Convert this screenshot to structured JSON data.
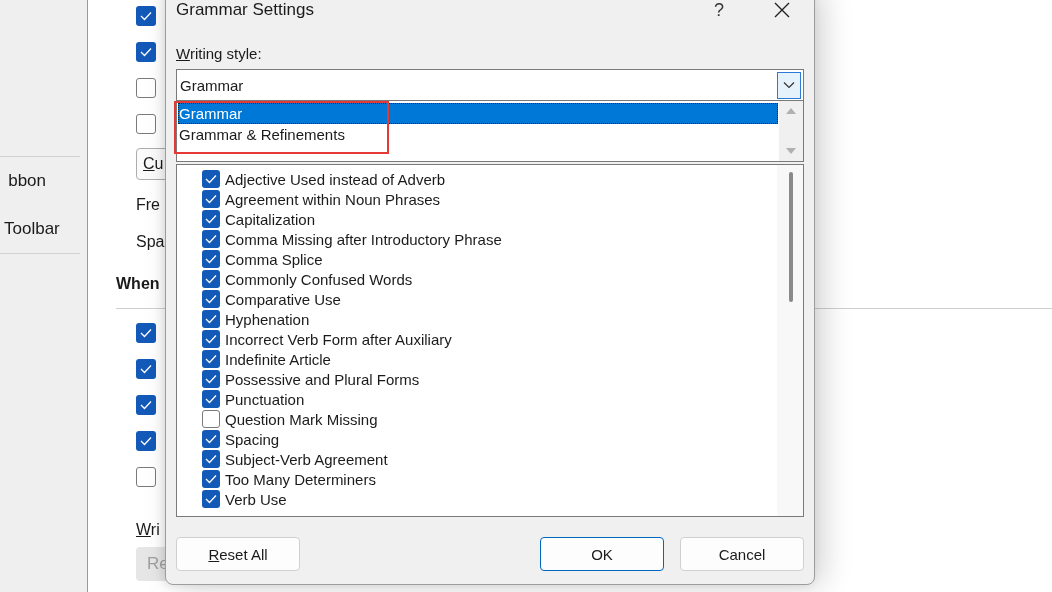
{
  "sidebar": {
    "items": [
      {
        "label": "bbon"
      },
      {
        "label": "Toolbar"
      }
    ]
  },
  "main": {
    "top_checkboxes": [
      {
        "checked": true
      },
      {
        "checked": true
      },
      {
        "checked": false
      },
      {
        "checked": false
      }
    ],
    "button": {
      "label": "Cu",
      "access_key": true
    },
    "rows": [
      {
        "label": "Fre"
      },
      {
        "label": "Spa"
      }
    ],
    "heading": "When",
    "bottom_checkboxes": [
      {
        "checked": true
      },
      {
        "checked": true
      },
      {
        "checked": true
      },
      {
        "checked": true
      },
      {
        "checked": false
      }
    ],
    "section_label": {
      "label": "Wri",
      "access_key": true
    },
    "section_button": {
      "label": "Re",
      "disabled": true
    }
  },
  "dialog": {
    "title": "Grammar Settings",
    "help": "?",
    "writing_style": {
      "label": "Writing style:",
      "access_key": true,
      "value": "Grammar",
      "options": [
        {
          "label": "Grammar",
          "selected": true
        },
        {
          "label": "Grammar & Refinements",
          "selected": false
        }
      ]
    },
    "rules": [
      {
        "label": "Adjective Used instead of Adverb",
        "checked": true
      },
      {
        "label": "Agreement within Noun Phrases",
        "checked": true
      },
      {
        "label": "Capitalization",
        "checked": true
      },
      {
        "label": "Comma Missing after Introductory Phrase",
        "checked": true
      },
      {
        "label": "Comma Splice",
        "checked": true
      },
      {
        "label": "Commonly Confused Words",
        "checked": true
      },
      {
        "label": "Comparative Use",
        "checked": true
      },
      {
        "label": "Hyphenation",
        "checked": true
      },
      {
        "label": "Incorrect Verb Form after Auxiliary",
        "checked": true
      },
      {
        "label": "Indefinite Article",
        "checked": true
      },
      {
        "label": "Possessive and Plural Forms",
        "checked": true
      },
      {
        "label": "Punctuation",
        "checked": true
      },
      {
        "label": "Question Mark Missing",
        "checked": false
      },
      {
        "label": "Spacing",
        "checked": true
      },
      {
        "label": "Subject-Verb Agreement",
        "checked": true
      },
      {
        "label": "Too Many Determiners",
        "checked": true
      },
      {
        "label": "Verb Use",
        "checked": true
      }
    ],
    "buttons": [
      {
        "label": "Reset All",
        "kind": "secondary",
        "access_key": true
      },
      {
        "label": "OK",
        "kind": "default",
        "access_key": false
      },
      {
        "label": "Cancel",
        "kind": "secondary",
        "access_key": false
      }
    ]
  }
}
